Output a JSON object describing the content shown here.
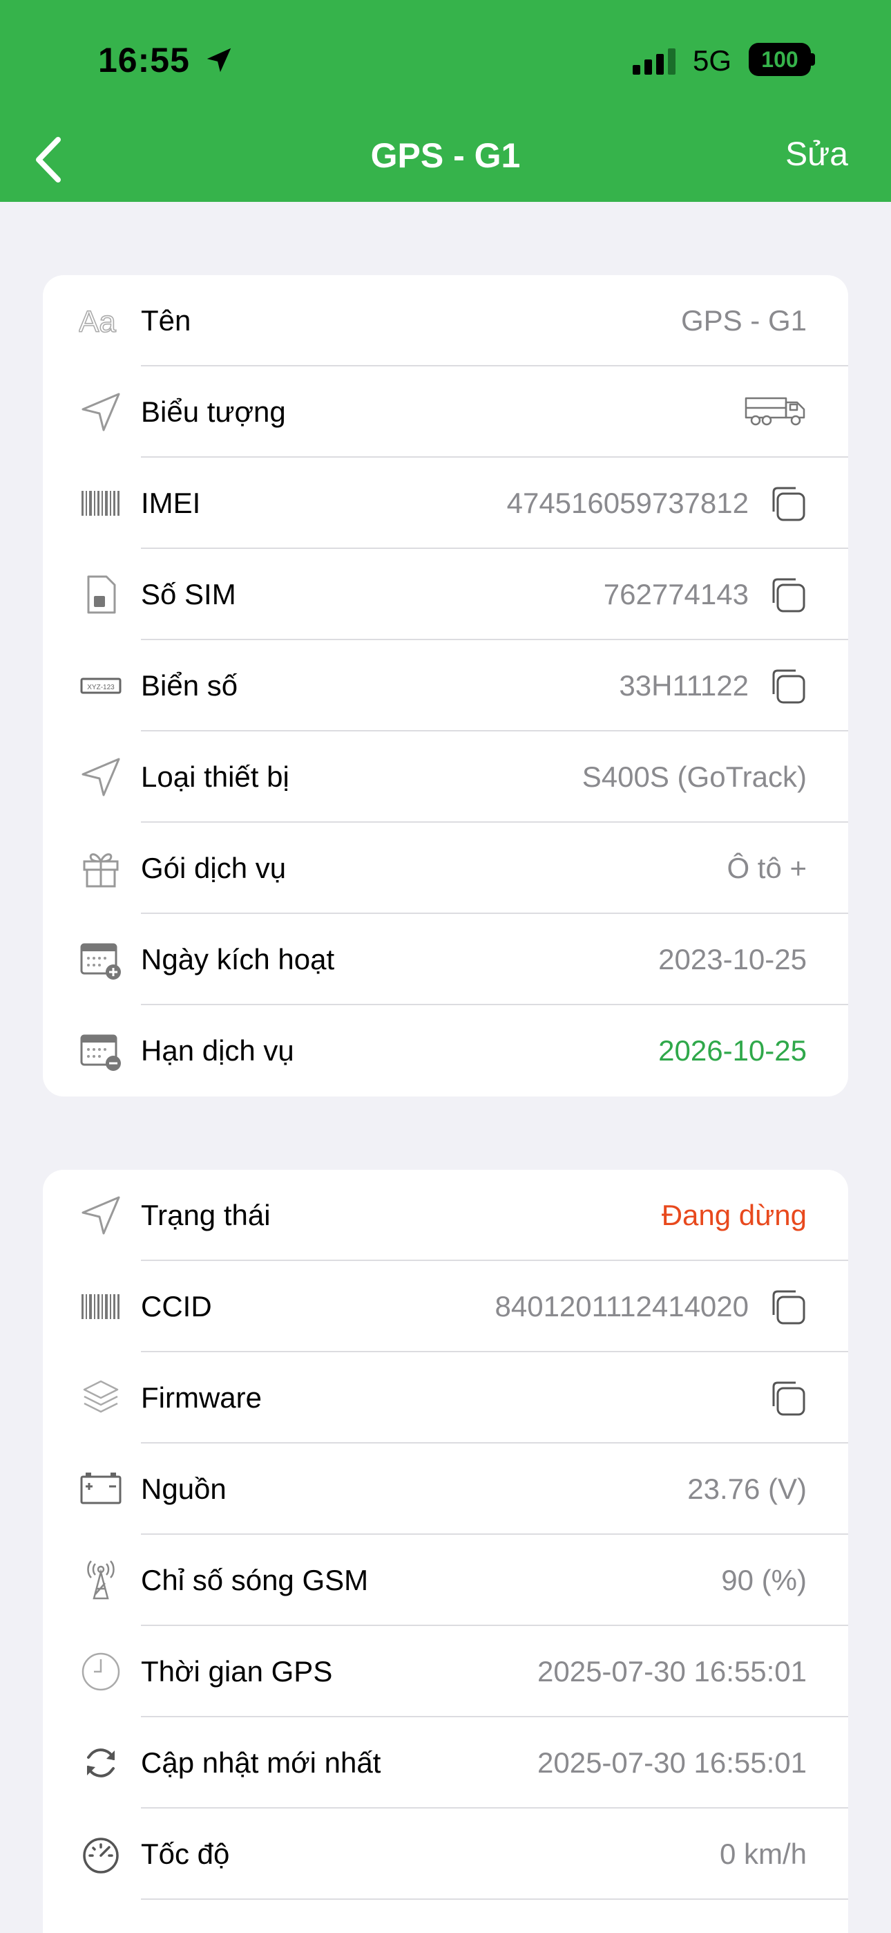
{
  "status_bar": {
    "time": "16:55",
    "network": "5G",
    "battery": "100"
  },
  "nav": {
    "title": "GPS - G1",
    "edit_label": "Sửa"
  },
  "device_info": [
    {
      "label": "Tên",
      "value": "GPS - G1",
      "icon": "font-aa-icon"
    },
    {
      "label": "Biểu tượng",
      "value": "",
      "icon": "navigation-arrow-icon",
      "value_icon": "truck-icon"
    },
    {
      "label": "IMEI",
      "value": "474516059737812",
      "icon": "barcode-icon",
      "copy": true
    },
    {
      "label": "Số SIM",
      "value": "762774143",
      "icon": "sim-card-icon",
      "copy": true
    },
    {
      "label": "Biển số",
      "value": "33H11122",
      "icon": "license-plate-icon",
      "copy": true
    },
    {
      "label": "Loại thiết bị",
      "value": "S400S (GoTrack)",
      "icon": "navigation-arrow-icon"
    },
    {
      "label": "Gói dịch vụ",
      "value": "Ô tô +",
      "icon": "gift-icon"
    },
    {
      "label": "Ngày kích hoạt",
      "value": "2023-10-25",
      "icon": "calendar-add-icon"
    },
    {
      "label": "Hạn dịch vụ",
      "value": "2026-10-25",
      "icon": "calendar-remove-icon",
      "value_color": "#2fa84a"
    }
  ],
  "status_info": [
    {
      "label": "Trạng thái",
      "value": "Đang dừng",
      "icon": "navigation-arrow-icon",
      "value_color": "#e8491d"
    },
    {
      "label": "CCID",
      "value": "8401201112414020",
      "icon": "barcode-icon",
      "copy": true
    },
    {
      "label": "Firmware",
      "value": "",
      "icon": "layers-icon",
      "copy": true
    },
    {
      "label": "Nguồn",
      "value": "23.76 (V)",
      "icon": "battery-icon"
    },
    {
      "label": "Chỉ số sóng GSM",
      "value": "90 (%)",
      "icon": "antenna-icon"
    },
    {
      "label": "Thời gian GPS",
      "value": "2025-07-30 16:55:01",
      "icon": "clock-icon"
    },
    {
      "label": "Cập nhật mới nhất",
      "value": "2025-07-30 16:55:01",
      "icon": "refresh-icon"
    },
    {
      "label": "Tốc độ",
      "value": "0 km/h",
      "icon": "speedometer-icon"
    }
  ],
  "colors": {
    "header": "#36b34b",
    "background": "#f1f1f6",
    "value_gray": "#8a8a8e",
    "green": "#2fa84a",
    "red": "#e8491d"
  }
}
